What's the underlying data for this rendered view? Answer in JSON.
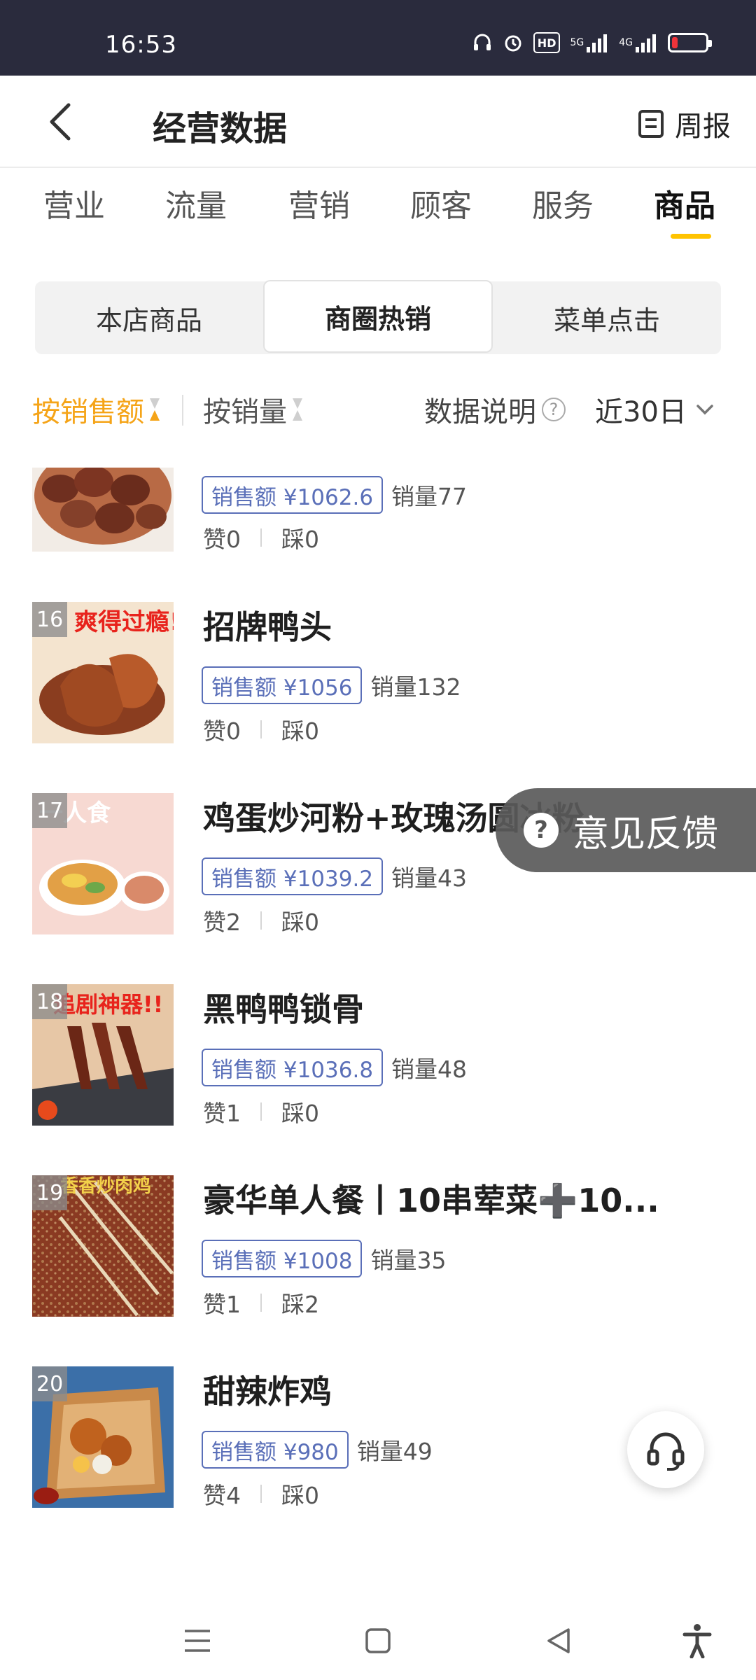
{
  "status_bar": {
    "time": "16:53",
    "hd_label": "HD",
    "net_5g": "5G",
    "net_4g": "4G",
    "battery_level": 0.15
  },
  "header": {
    "title": "经营数据",
    "weekly_label": "周报"
  },
  "category_tabs": [
    {
      "label": "营业",
      "active": false
    },
    {
      "label": "流量",
      "active": false
    },
    {
      "label": "营销",
      "active": false
    },
    {
      "label": "顾客",
      "active": false
    },
    {
      "label": "服务",
      "active": false
    },
    {
      "label": "商品",
      "active": true
    }
  ],
  "segments": [
    {
      "label": "本店商品",
      "active": false
    },
    {
      "label": "商圈热销",
      "active": true
    },
    {
      "label": "菜单点击",
      "active": false
    }
  ],
  "sort_bar": {
    "by_sales_amount": "按销售额",
    "by_sales_volume": "按销量",
    "data_desc": "数据说明",
    "date_range": "近30日"
  },
  "products": [
    {
      "rank": "",
      "name": "",
      "sales": "销售额 ¥1062.6",
      "volume": "销量77",
      "likes": "赞0",
      "dislikes": "踩0"
    },
    {
      "rank": "16",
      "name": "招牌鸭头",
      "sales": "销售额 ¥1056",
      "volume": "销量132",
      "likes": "赞0",
      "dislikes": "踩0",
      "thumb_text": "爽得过瘾!!"
    },
    {
      "rank": "17",
      "name": "鸡蛋炒河粉+玫瑰汤圆冰粉",
      "sales": "销售额 ¥1039.2",
      "volume": "销量43",
      "likes": "赞2",
      "dislikes": "踩0",
      "thumb_text": "一人食"
    },
    {
      "rank": "18",
      "name": "黑鸭鸭锁骨",
      "sales": "销售额 ¥1036.8",
      "volume": "销量48",
      "likes": "赞1",
      "dislikes": "踩0",
      "thumb_text": "追剧神器!!"
    },
    {
      "rank": "19",
      "name": "豪华单人餐丨10串荤菜➕10...",
      "sales": "销售额 ¥1008",
      "volume": "销量35",
      "likes": "赞1",
      "dislikes": "踩2",
      "thumb_text": "香香炒肉鸡"
    },
    {
      "rank": "20",
      "name": "甜辣炸鸡",
      "sales": "销售额 ¥980",
      "volume": "销量49",
      "likes": "赞4",
      "dislikes": "踩0"
    }
  ],
  "feedback": {
    "label": "意见反馈",
    "icon": "question-icon"
  },
  "support": {
    "icon": "headset-icon"
  },
  "nav_bar": {
    "icons": [
      "menu-icon",
      "home-square-icon",
      "back-triangle-icon",
      "accessibility-icon"
    ]
  },
  "colors": {
    "accent_yellow": "#ffc300",
    "sort_active": "#f5a418",
    "badge_blue": "#5a6fb8",
    "status_bar": "#2a2b3d"
  }
}
